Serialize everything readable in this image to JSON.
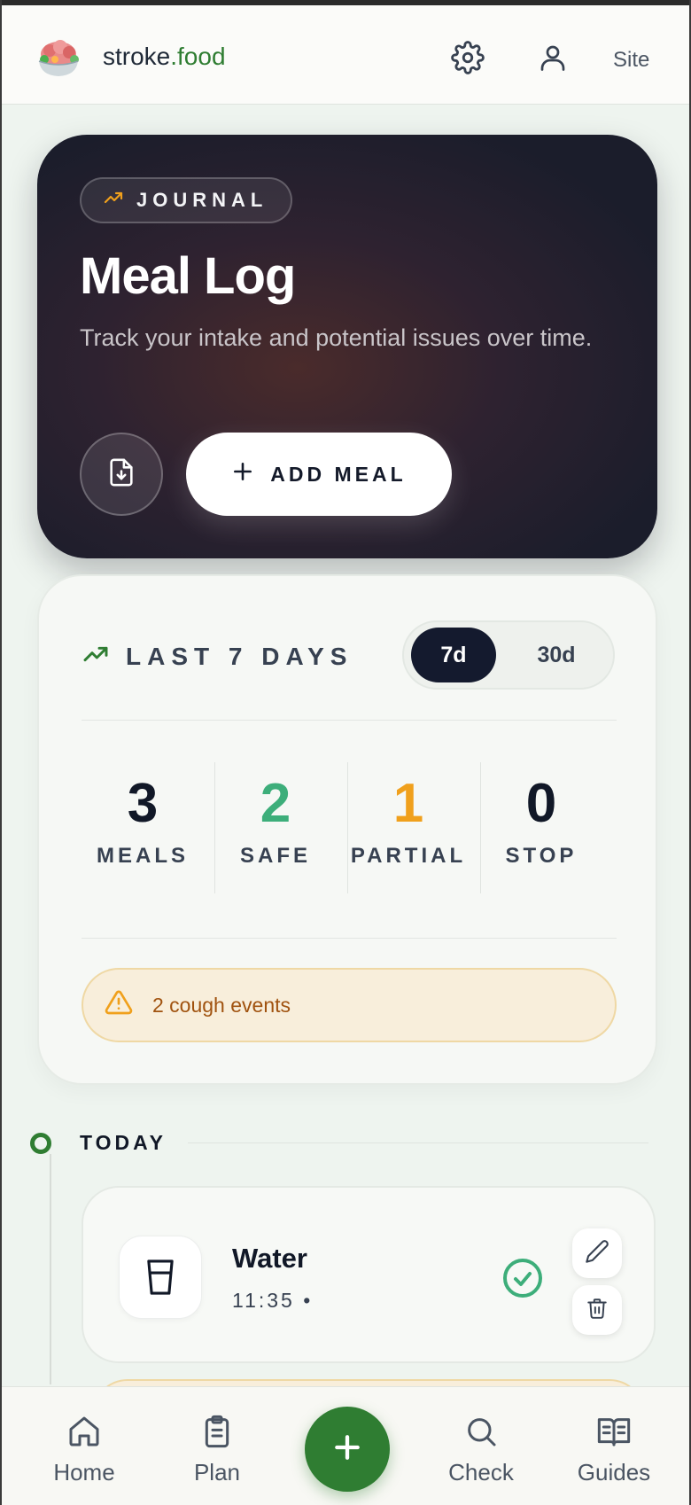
{
  "header": {
    "brand_main": "stroke",
    "brand_accent": ".food",
    "site_label": "Site",
    "icons": [
      "logo-bowl-icon",
      "settings-icon",
      "profile-icon"
    ]
  },
  "hero": {
    "pill_label": "JOURNAL",
    "title": "Meal Log",
    "subtitle": "Track your intake and potential issues over time.",
    "add_label": "ADD MEAL",
    "icons": [
      "trend-up-icon",
      "export-file-icon",
      "plus-icon"
    ]
  },
  "stats": {
    "title": "LAST 7 DAYS",
    "range_options": [
      "7d",
      "30d"
    ],
    "range_selected": "7d",
    "items": [
      {
        "value": "3",
        "label": "MEALS",
        "color": "#111827"
      },
      {
        "value": "2",
        "label": "SAFE",
        "color": "#3dae7a"
      },
      {
        "value": "1",
        "label": "PARTIAL",
        "color": "#f0a01c"
      },
      {
        "value": "0",
        "label": "STOP",
        "color": "#111827"
      }
    ],
    "alert_text": "2 cough events"
  },
  "timeline": {
    "group_label": "TODAY",
    "entries": [
      {
        "name": "Water",
        "meta": "11:35  •",
        "status": "safe",
        "icon": "glass-icon"
      }
    ]
  },
  "bottom_nav": {
    "items": [
      {
        "label": "Home",
        "icon": "home-icon"
      },
      {
        "label": "Plan",
        "icon": "clipboard-icon"
      },
      {
        "label": "Check",
        "icon": "search-icon"
      },
      {
        "label": "Guides",
        "icon": "book-icon"
      }
    ],
    "fab_icon": "plus-icon"
  },
  "colors": {
    "brand_green": "#2f7d32",
    "safe": "#3dae7a",
    "partial": "#f0a01c",
    "dark": "#141a2e",
    "warning_text": "#a0520f"
  }
}
